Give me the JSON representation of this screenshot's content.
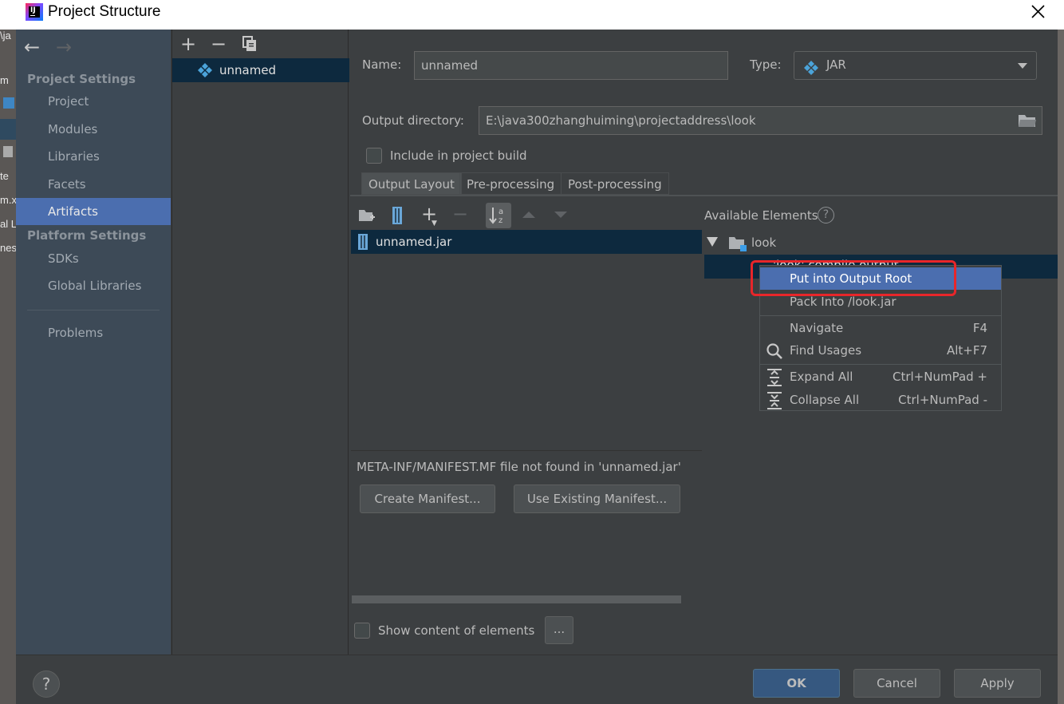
{
  "window": {
    "title": "Project Structure"
  },
  "background_peek": [
    "\\ja",
    "m",
    "te",
    "m.x",
    "al L",
    "nes"
  ],
  "nav": {
    "back": "←",
    "forward": "→"
  },
  "sidebar": {
    "project_settings_header": "Project Settings",
    "platform_settings_header": "Platform Settings",
    "items": [
      {
        "label": "Project"
      },
      {
        "label": "Modules"
      },
      {
        "label": "Libraries"
      },
      {
        "label": "Facets"
      },
      {
        "label": "Artifacts",
        "selected": true
      },
      {
        "label": "SDKs"
      },
      {
        "label": "Global Libraries"
      },
      {
        "label": "Problems"
      }
    ]
  },
  "artifact_list": {
    "toolbar": [
      "+",
      "−",
      "copy-icon"
    ],
    "items": [
      {
        "label": "unnamed",
        "icon": "jar-artifact-icon"
      }
    ]
  },
  "form": {
    "name_label": "Name:",
    "name_value": "unnamed",
    "type_label": "Type:",
    "type_value": "JAR",
    "output_dir_label": "Output directory:",
    "output_dir_value": "E:\\java300zhanghuiming\\projectaddress\\look",
    "include_build_label": "Include in project build",
    "include_build_checked": false
  },
  "tabs": [
    {
      "label": "Output Layout",
      "active": true
    },
    {
      "label": "Pre-processing"
    },
    {
      "label": "Post-processing"
    }
  ],
  "layout": {
    "items": [
      {
        "label": "unnamed.jar"
      }
    ],
    "manifest_message": "META-INF/MANIFEST.MF file not found in 'unnamed.jar'",
    "create_manifest": "Create Manifest...",
    "use_existing_manifest": "Use Existing Manifest...",
    "show_content_label": "Show content of elements",
    "more_button": "..."
  },
  "available": {
    "title": "Available Elements",
    "tree": [
      {
        "label": "look",
        "expanded": true
      },
      {
        "label": "'look' compile output"
      }
    ]
  },
  "context_menu": {
    "items": [
      {
        "label": "Put into Output Root",
        "shortcut": "",
        "selected": true
      },
      {
        "label": "Pack Into /look.jar",
        "shortcut": ""
      },
      {
        "label": "Navigate",
        "shortcut": "F4"
      },
      {
        "label": "Find Usages",
        "shortcut": "Alt+F7"
      },
      {
        "label": "Expand All",
        "shortcut": "Ctrl+NumPad +"
      },
      {
        "label": "Collapse All",
        "shortcut": "Ctrl+NumPad -"
      }
    ]
  },
  "footer": {
    "ok": "OK",
    "cancel": "Cancel",
    "apply": "Apply",
    "help": "?"
  },
  "colors": {
    "highlight": "#e8262a",
    "selection": "#4b6eaf",
    "dark_selection": "#0d293e",
    "sidebar_bg": "#3d4a57"
  }
}
